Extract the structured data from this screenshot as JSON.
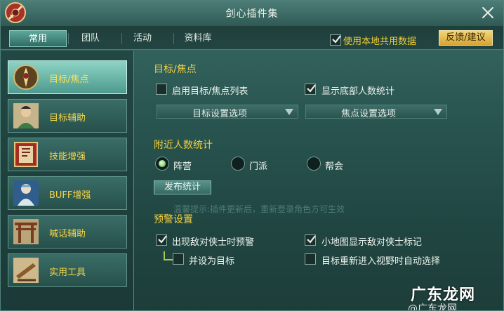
{
  "window": {
    "title": "剑心插件集",
    "close_icon": "close-icon",
    "logo_icon": "sword-logo-icon"
  },
  "tabs": [
    {
      "label": "常用",
      "active": true
    },
    {
      "label": "团队",
      "active": false
    },
    {
      "label": "活动",
      "active": false
    },
    {
      "label": "资料库",
      "active": false
    }
  ],
  "header_options": {
    "share_data": {
      "label": "使用本地共用数据",
      "checked": true
    },
    "feedback_label": "反馈/建议"
  },
  "sidebar": {
    "items": [
      {
        "label": "目标/焦点",
        "icon": "target-focus-icon",
        "active": true
      },
      {
        "label": "目标辅助",
        "icon": "character-portrait-icon",
        "active": false
      },
      {
        "label": "技能增强",
        "icon": "skill-book-icon",
        "active": false
      },
      {
        "label": "BUFF增强",
        "icon": "buff-warrior-icon",
        "active": false
      },
      {
        "label": "喊话辅助",
        "icon": "gate-icon",
        "active": false
      },
      {
        "label": "实用工具",
        "icon": "scroll-tools-icon",
        "active": false
      }
    ]
  },
  "main": {
    "target_section": {
      "title": "目标/焦点",
      "enable_list": {
        "label": "启用目标/焦点列表",
        "checked": false
      },
      "show_bottom_count": {
        "label": "显示底部人数统计",
        "checked": true
      },
      "target_dropdown": "目标设置选项",
      "focus_dropdown": "焦点设置选项"
    },
    "nearby_section": {
      "title": "附近人数统计",
      "radios": [
        {
          "label": "阵营",
          "selected": true
        },
        {
          "label": "门派",
          "selected": false
        },
        {
          "label": "帮会",
          "selected": false
        }
      ],
      "publish_label": "发布统计",
      "hint": "温馨提示:插件更新后，重新登录角色方可生效"
    },
    "warning_section": {
      "title": "预警设置",
      "warn_enemy": {
        "label": "出现敌对侠士时预警",
        "checked": true
      },
      "set_as_target": {
        "label": "并设为目标",
        "checked": false
      },
      "minimap_mark": {
        "label": "小地图显示敌对侠士标记",
        "checked": true
      },
      "auto_select": {
        "label": "目标重新进入视野时自动选择",
        "checked": false
      }
    }
  },
  "watermark": {
    "text": "广东龙网",
    "sub": "@广东龙网"
  },
  "colors": {
    "accent_yellow": "#f3cf3e",
    "panel_teal": "#2a5651",
    "active_tab": "#5fa79c"
  }
}
